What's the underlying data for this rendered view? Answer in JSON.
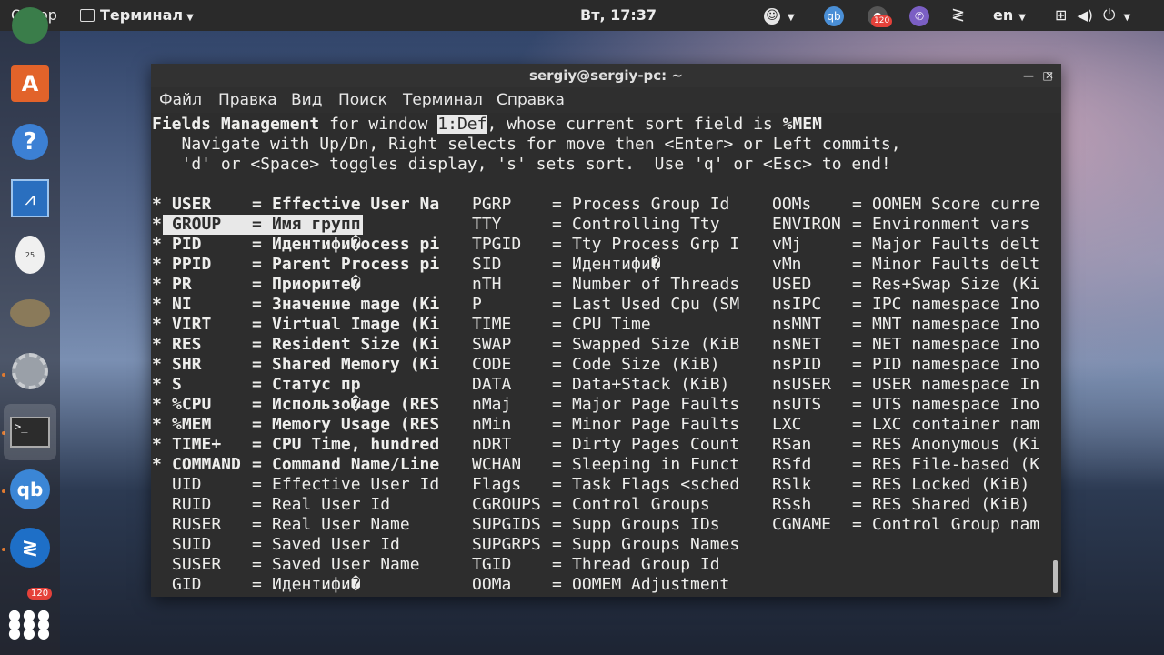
{
  "topbar": {
    "activities": "Обзор",
    "app_menu": "Терминал",
    "clock": "Вт, 17:37",
    "lang": "en",
    "badge_count": "120"
  },
  "dock": {
    "badge_count": "120"
  },
  "terminal": {
    "title": "sergiy@sergiy-pc: ~",
    "menu": [
      "Файл",
      "Правка",
      "Вид",
      "Поиск",
      "Терминал",
      "Справка"
    ],
    "header": {
      "part1": "Fields Management",
      "part2": " for window ",
      "window": "1:Def",
      "part3": ", whose current sort field is ",
      "sort_field": "%MEM",
      "line2": "   Navigate with Up/Dn, Right selects for move then <Enter> or Left commits,",
      "line3": "   'd' or <Space> toggles display, 's' sets sort.  Use 'q' or <Esc> to end!"
    },
    "col1": [
      {
        "mark": "*",
        "name": "USER",
        "desc": "Effective User Na",
        "bold": true
      },
      {
        "mark": "*",
        "name": "GROUP",
        "desc": "Имя групп",
        "bold": true,
        "selected": true
      },
      {
        "mark": "*",
        "name": "PID",
        "desc": "Идентифи�ocess pi",
        "bold": true
      },
      {
        "mark": "*",
        "name": "PPID",
        "desc": "Parent Process pi",
        "bold": true
      },
      {
        "mark": "*",
        "name": "PR",
        "desc": "Приорите�",
        "bold": true
      },
      {
        "mark": "*",
        "name": "NI",
        "desc": "Значение mage (Ki",
        "bold": true
      },
      {
        "mark": "*",
        "name": "VIRT",
        "desc": "Virtual Image (Ki",
        "bold": true
      },
      {
        "mark": "*",
        "name": "RES",
        "desc": "Resident Size (Ki",
        "bold": true
      },
      {
        "mark": "*",
        "name": "SHR",
        "desc": "Shared Memory (Ki",
        "bold": true
      },
      {
        "mark": "*",
        "name": "S",
        "desc": "Статус пр",
        "bold": true
      },
      {
        "mark": "*",
        "name": "%CPU",
        "desc": "Использо�age (RES",
        "bold": true
      },
      {
        "mark": "*",
        "name": "%MEM",
        "desc": "Memory Usage (RES",
        "bold": true
      },
      {
        "mark": "*",
        "name": "TIME+",
        "desc": "CPU Time, hundred",
        "bold": true
      },
      {
        "mark": "*",
        "name": "COMMAND",
        "desc": "Command Name/Line",
        "bold": true
      },
      {
        "mark": " ",
        "name": "UID",
        "desc": "Effective User Id",
        "bold": false
      },
      {
        "mark": " ",
        "name": "RUID",
        "desc": "Real User Id",
        "bold": false
      },
      {
        "mark": " ",
        "name": "RUSER",
        "desc": "Real User Name",
        "bold": false
      },
      {
        "mark": " ",
        "name": "SUID",
        "desc": "Saved User Id",
        "bold": false
      },
      {
        "mark": " ",
        "name": "SUSER",
        "desc": "Saved User Name",
        "bold": false
      },
      {
        "mark": " ",
        "name": "GID",
        "desc": "Идентифи�",
        "bold": false
      }
    ],
    "col2": [
      {
        "name": "PGRP",
        "desc": "Process Group Id"
      },
      {
        "name": "TTY",
        "desc": "Controlling Tty"
      },
      {
        "name": "TPGID",
        "desc": "Tty Process Grp I"
      },
      {
        "name": "SID",
        "desc": "Идентифи�"
      },
      {
        "name": "nTH",
        "desc": "Number of Threads"
      },
      {
        "name": "P",
        "desc": "Last Used Cpu (SM"
      },
      {
        "name": "TIME",
        "desc": "CPU Time"
      },
      {
        "name": "SWAP",
        "desc": "Swapped Size (KiB"
      },
      {
        "name": "CODE",
        "desc": "Code Size (KiB)"
      },
      {
        "name": "DATA",
        "desc": "Data+Stack (KiB)"
      },
      {
        "name": "nMaj",
        "desc": "Major Page Faults"
      },
      {
        "name": "nMin",
        "desc": "Minor Page Faults"
      },
      {
        "name": "nDRT",
        "desc": "Dirty Pages Count"
      },
      {
        "name": "WCHAN",
        "desc": "Sleeping in Funct"
      },
      {
        "name": "Flags",
        "desc": "Task Flags <sched"
      },
      {
        "name": "CGROUPS",
        "desc": "Control Groups"
      },
      {
        "name": "SUPGIDS",
        "desc": "Supp Groups IDs"
      },
      {
        "name": "SUPGRPS",
        "desc": "Supp Groups Names"
      },
      {
        "name": "TGID",
        "desc": "Thread Group Id"
      },
      {
        "name": "OOMa",
        "desc": "OOMEM Adjustment"
      }
    ],
    "col3": [
      {
        "name": "OOMs",
        "desc": "OOMEM Score curre"
      },
      {
        "name": "ENVIRON",
        "desc": "Environment vars"
      },
      {
        "name": "vMj",
        "desc": "Major Faults delt"
      },
      {
        "name": "vMn",
        "desc": "Minor Faults delt"
      },
      {
        "name": "USED",
        "desc": "Res+Swap Size (Ki"
      },
      {
        "name": "nsIPC",
        "desc": "IPC namespace Ino"
      },
      {
        "name": "nsMNT",
        "desc": "MNT namespace Ino"
      },
      {
        "name": "nsNET",
        "desc": "NET namespace Ino"
      },
      {
        "name": "nsPID",
        "desc": "PID namespace Ino"
      },
      {
        "name": "nsUSER",
        "desc": "USER namespace In"
      },
      {
        "name": "nsUTS",
        "desc": "UTS namespace Ino"
      },
      {
        "name": "LXC",
        "desc": "LXC container nam"
      },
      {
        "name": "RSan",
        "desc": "RES Anonymous (Ki"
      },
      {
        "name": "RSfd",
        "desc": "RES File-based (K"
      },
      {
        "name": "RSlk",
        "desc": "RES Locked (KiB)"
      },
      {
        "name": "RSsh",
        "desc": "RES Shared (KiB)"
      },
      {
        "name": "CGNAME",
        "desc": "Control Group nam"
      }
    ]
  }
}
